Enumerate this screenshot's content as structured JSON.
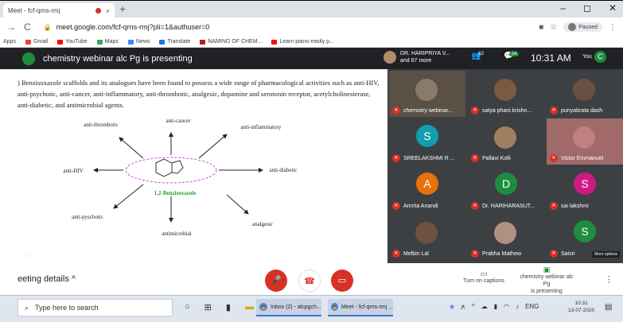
{
  "browser": {
    "tab_title": "Meet - fcf-qrns-rmj",
    "tab_close": "×",
    "new_tab": "+",
    "window_controls": [
      "–",
      "◻",
      "✕"
    ],
    "url": "meet.google.com/fcf-qrns-rmj?pli=1&authuser=0",
    "profile_status": "Paused",
    "bookmarks": [
      "Apps",
      "Gmail",
      "YouTube",
      "Maps",
      "News",
      "Translate",
      "NAMING OF CHEM...",
      "Learn piano easily p..."
    ]
  },
  "meet": {
    "presenting_title": "chemistry webinar alc Pg is presenting",
    "presenter_name": "DR. HARIPRIYA V...",
    "presenter_more": "and 67 more",
    "participants_count": "62",
    "chat_count": "24",
    "time": "10:31 AM",
    "you_label": "You",
    "you_initial": "C"
  },
  "slide": {
    "paragraph": ") Benzisoxazole scaffolds and its analogues have been found to possess a wide range of pharmacological activities such as anti-HIV, anti-psychotic, anti-cancer, anti-inflammatory, anti-thrombotic, analgesic, dopamine and serotonin receptor, acetylcholinesterase, anti-diabetic, and antimicrobial agents.",
    "center_label": "1,2-Benzisoxazole",
    "activities": {
      "top": "anti-cancer",
      "top_left": "anti-thrombotic",
      "top_right": "anti-inflammatory",
      "left": "anti-HIV",
      "right": "anti-diabetic",
      "bottom_left": "anti-pyschotic",
      "bottom": "antimicrobial",
      "bottom_right": "analgesic"
    }
  },
  "participants": [
    {
      "name": "chemistry webinar...",
      "initial": "",
      "color": "#8a7a6a"
    },
    {
      "name": "satya phani krishn...",
      "initial": "",
      "color": "#7a5a40"
    },
    {
      "name": "punyabrata dash",
      "initial": "",
      "color": "#6a5040"
    },
    {
      "name": "SREELAKSHMI R ...",
      "initial": "S",
      "color": "#129eaf"
    },
    {
      "name": "Pallavi Kolli",
      "initial": "",
      "color": "#a08060"
    },
    {
      "name": "Victor Emmanuel",
      "initial": "",
      "color": "#c08080"
    },
    {
      "name": "Amrita Anandi",
      "initial": "A",
      "color": "#e8710a"
    },
    {
      "name": "Dr. HARIHARASUT...",
      "initial": "D",
      "color": "#1e8e3e"
    },
    {
      "name": "sai lakshmi",
      "initial": "S",
      "color": "#d01884"
    },
    {
      "name": "Melbin Lal",
      "initial": "",
      "color": "#705040"
    },
    {
      "name": "Prabha Mathew",
      "initial": "",
      "color": "#b09080"
    },
    {
      "name": "Saisri",
      "initial": "S",
      "color": "#1e8e3e"
    }
  ],
  "more_options": "More options",
  "controls": {
    "meeting_details": "eeting details",
    "captions": "Turn on captions",
    "presenting_line1": "chemistry webinar alc Pg",
    "presenting_line2": "is presenting"
  },
  "taskbar": {
    "search_placeholder": "Type here to search",
    "app1": "Inbox (2) - alcpgch...",
    "app2": "Meet - fcf-qrns-rmj ...",
    "lang": "ENG",
    "time": "10:31",
    "date": "13-07-2020"
  }
}
